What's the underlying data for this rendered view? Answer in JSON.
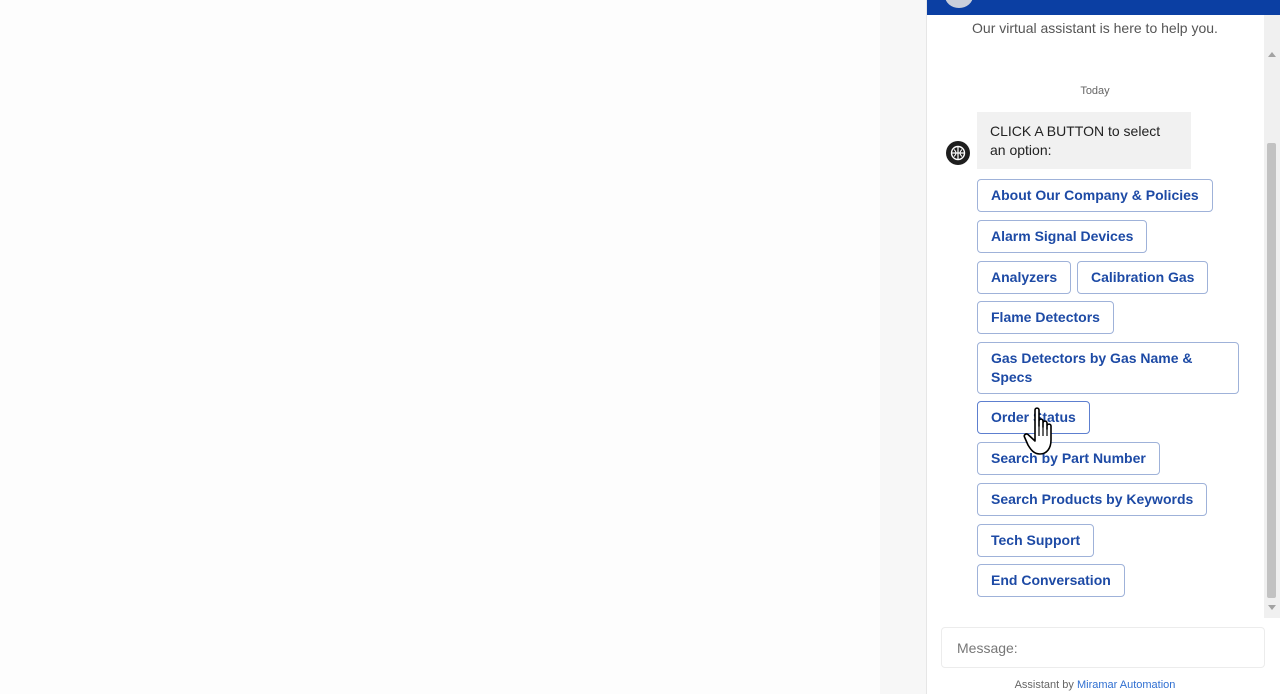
{
  "chat": {
    "subtitle": "Our virtual assistant is here to help you.",
    "day_label": "Today",
    "bot_message": "CLICK A BUTTON to select an option:",
    "options": [
      "About Our Company & Policies",
      "Alarm Signal Devices",
      "Analyzers",
      "Calibration Gas",
      "Flame Detectors",
      "Gas Detectors by Gas Name & Specs",
      "Order Status",
      "Search by Part Number",
      "Search Products by Keywords",
      "Tech Support",
      "End Conversation"
    ],
    "input_placeholder": "Message:",
    "footer_prefix": "Assistant by",
    "footer_link": "Miramar Automation",
    "header_color": "#0b3fa3",
    "accent_color": "#1d4aa5"
  },
  "icons": {
    "bot_avatar": "bot-logo-icon",
    "cursor": "hand-pointer-icon"
  }
}
